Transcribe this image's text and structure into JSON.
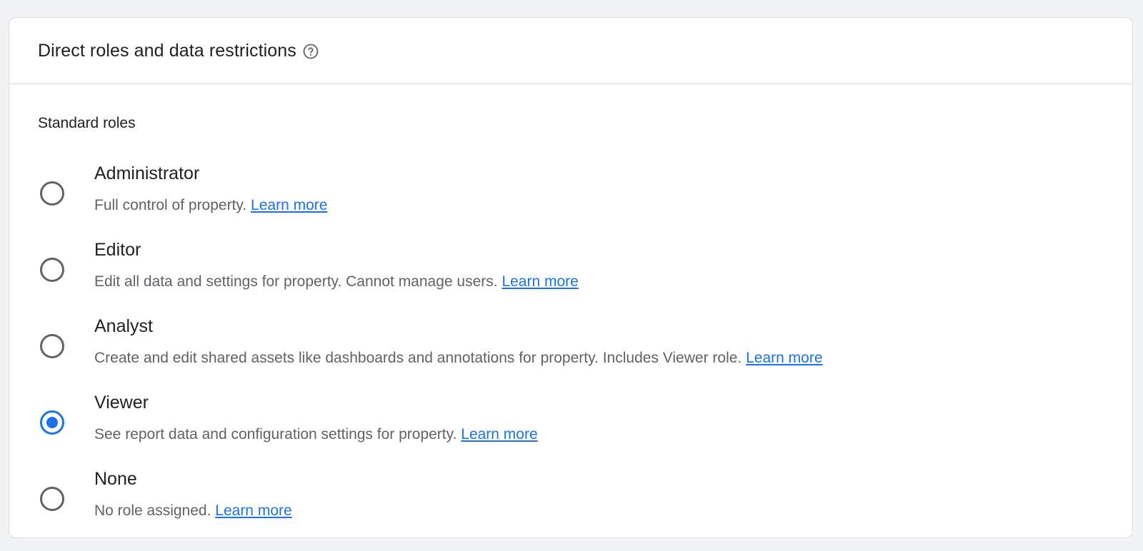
{
  "header": {
    "title": "Direct roles and data restrictions",
    "help_icon": "help-circle-icon"
  },
  "section": {
    "label": "Standard roles"
  },
  "colors": {
    "accent": "#1a73e8",
    "radio_unchecked": "#5f6368",
    "text_primary": "#202124",
    "text_secondary": "#5f6368"
  },
  "roles": [
    {
      "name": "Administrator",
      "description": "Full control of property.",
      "link": "Learn more",
      "selected": false
    },
    {
      "name": "Editor",
      "description": "Edit all data and settings for property. Cannot manage users.",
      "link": "Learn more",
      "selected": false
    },
    {
      "name": "Analyst",
      "description": "Create and edit shared assets like dashboards and annotations for property. Includes Viewer role.",
      "link": "Learn more",
      "selected": false
    },
    {
      "name": "Viewer",
      "description": "See report data and configuration settings for property.",
      "link": "Learn more",
      "selected": true
    },
    {
      "name": "None",
      "description": "No role assigned.",
      "link": "Learn more",
      "selected": false
    }
  ]
}
